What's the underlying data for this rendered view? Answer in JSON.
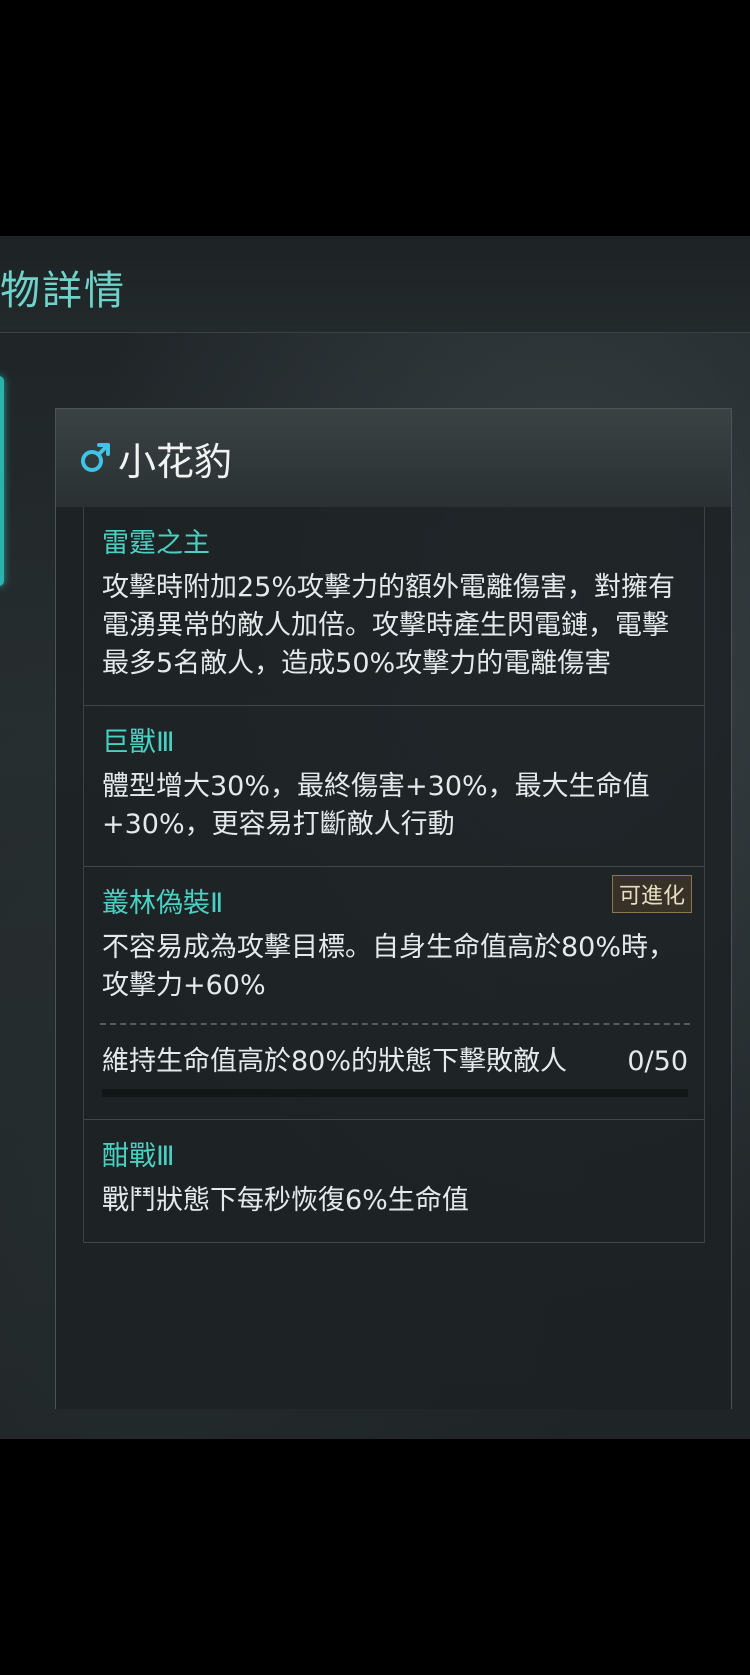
{
  "page_title": "物詳情",
  "pet": {
    "gender_icon": "male-symbol-icon",
    "name": "小花豹"
  },
  "skills": [
    {
      "title": "雷霆之主",
      "desc": "攻擊時附加25%攻擊力的額外電離傷害，對擁有電湧異常的敵人加倍。攻擊時產生閃電鏈，電擊最多5名敵人，造成50%攻擊力的電離傷害"
    },
    {
      "title": "巨獸Ⅲ",
      "desc": "體型增大30%，最終傷害+30%，最大生命值+30%，更容易打斷敵人行動"
    },
    {
      "title": "叢林偽裝Ⅱ",
      "badge": "可進化",
      "desc": "不容易成為攻擊目標。自身生命值高於80%時，攻擊力+60%",
      "task": {
        "text": "維持生命值高於80%的狀態下擊敗敵人",
        "count": "0/50",
        "progress": 0
      }
    },
    {
      "title": "酣戰Ⅲ",
      "desc": "戰鬥狀態下每秒恢復6%生命值"
    }
  ],
  "colors": {
    "accent": "#49d0c2",
    "title": "#6fd3c9",
    "badge_border": "#8a7650"
  }
}
